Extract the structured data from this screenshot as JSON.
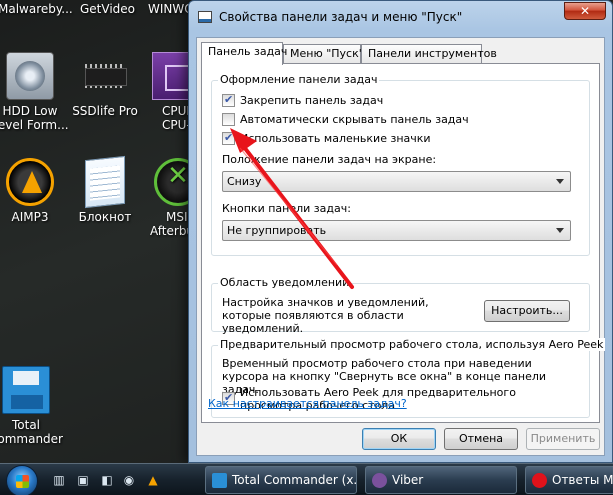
{
  "desktop": {
    "top_labels": [
      "Malwareby...",
      "GetVideo",
      "WINWO"
    ],
    "icons": [
      {
        "label1": "HDD Low",
        "label2": "Level Form..."
      },
      {
        "label1": "SSDlife Pro",
        "label2": ""
      },
      {
        "label1": "CPUI",
        "label2": "CPU-..."
      },
      {
        "label1": "AIMP3",
        "label2": ""
      },
      {
        "label1": "Блокнот",
        "label2": ""
      },
      {
        "label1": "MSI",
        "label2": "Afterbu..."
      },
      {
        "label1": "Total",
        "label2": "Commander"
      }
    ]
  },
  "window": {
    "title": "Свойства панели задач и меню \"Пуск\"",
    "close_label": "✕",
    "tabs": [
      "Панель задач",
      "Меню \"Пуск\"",
      "Панели инструментов"
    ],
    "appearance": {
      "title": "Оформление панели задач",
      "lock": "Закрепить панель задач",
      "autohide": "Автоматически скрывать панель задач",
      "small_icons": "Использовать маленькие значки",
      "position_label": "Положение панели задач на экране:",
      "position_value": "Снизу",
      "buttons_label": "Кнопки панели задач:",
      "buttons_value": "Не группировать"
    },
    "notify": {
      "title": "Область уведомлений",
      "text": "Настройка значков и уведомлений, которые появляются в области уведомлений.",
      "button": "Настроить..."
    },
    "peek": {
      "title": "Предварительный просмотр рабочего стола, используя Aero Peek",
      "text": "Временный просмотр рабочего стола при наведении курсора на кнопку \"Свернуть все окна\" в конце панели задач.",
      "checkbox": "Использовать Aero Peek для предварительного просмотра рабочего стола"
    },
    "help_link": "Как настраивается панель задач?",
    "ok": "ОК",
    "cancel": "Отмена",
    "apply": "Применить"
  },
  "taskbar": {
    "tasks": [
      "Total Commander (x...",
      "Viber",
      "Ответы Ма..."
    ]
  },
  "colors": {
    "annotation_arrow": "#e8141b",
    "link": "#0066cc"
  }
}
